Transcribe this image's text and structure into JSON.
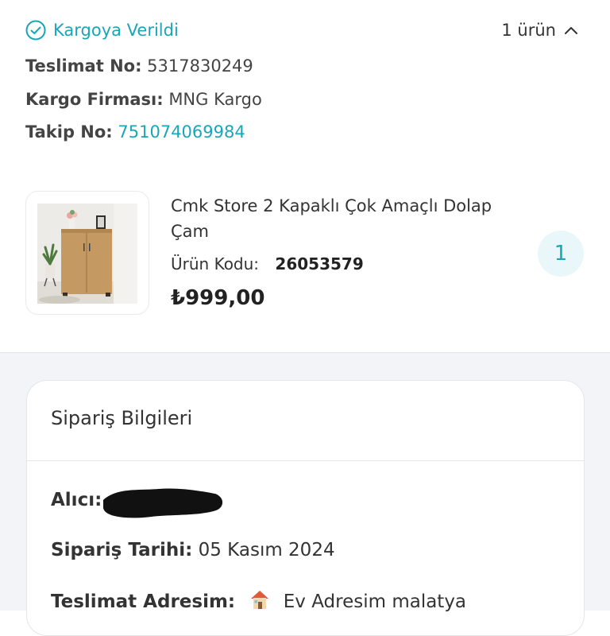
{
  "shipment": {
    "status": "Kargoya Verildi",
    "item_count": "1 ürün",
    "delivery_no_label": "Teslimat No:",
    "delivery_no": "5317830249",
    "carrier_label": "Kargo Firması:",
    "carrier": "MNG Kargo",
    "tracking_label": "Takip No:",
    "tracking_no": "751074069984"
  },
  "product": {
    "name": "Cmk Store 2 Kapaklı Çok Amaçlı Dolap Çam",
    "code_label": "Ürün Kodu:",
    "code": "26053579",
    "price": "₺999,00",
    "quantity": "1"
  },
  "order_info": {
    "title": "Sipariş Bilgileri",
    "recipient_label": "Alıcı:",
    "date_label": "Sipariş Tarihi:",
    "date": "05 Kasım 2024",
    "address_label": "Teslimat Adresim:",
    "address": "Ev Adresim malatya"
  },
  "colors": {
    "accent": "#19a6b8",
    "page_bg": "#f2f4f8",
    "qty_badge_bg": "#eaf7fa"
  },
  "icons": {
    "status": "check-circle-icon",
    "collapse": "chevron-up-icon",
    "address": "house-icon"
  }
}
